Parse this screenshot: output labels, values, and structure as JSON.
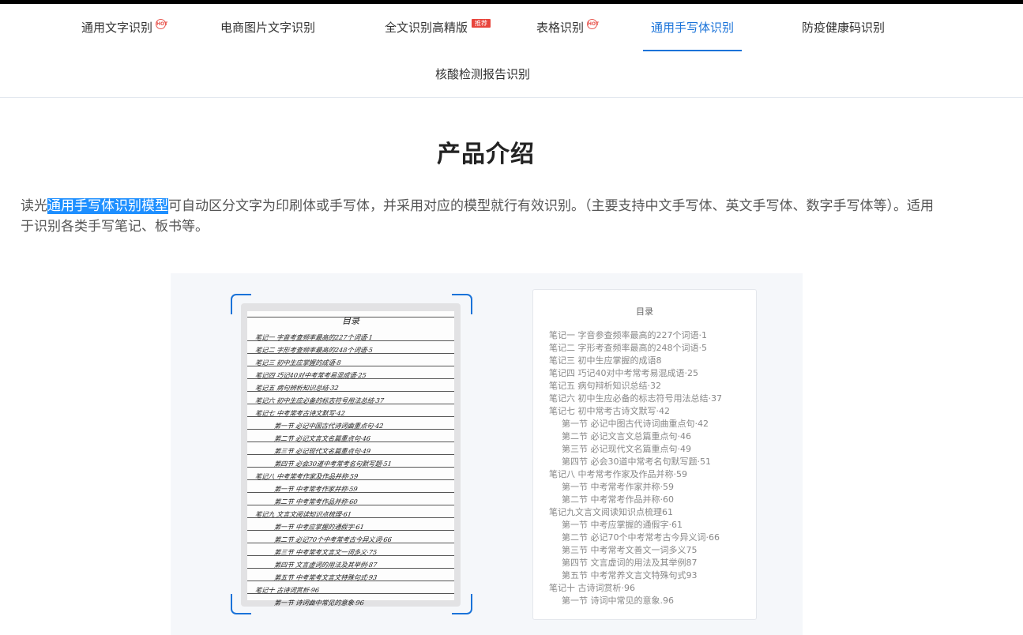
{
  "tabs": [
    {
      "label": "通用文字识别",
      "badge": "HOT"
    },
    {
      "label": "电商图片文字识别",
      "badge": ""
    },
    {
      "label": "全文识别高精版",
      "badge": "推荐"
    },
    {
      "label": "表格识别",
      "badge": "HOT"
    },
    {
      "label": "通用手写体识别",
      "badge": ""
    },
    {
      "label": "防疫健康码识别",
      "badge": ""
    },
    {
      "label": "核酸检测报告识别",
      "badge": ""
    }
  ],
  "section_title": "产品介绍",
  "intro": {
    "prefix": "读光",
    "highlight": "通用手写体识别模型",
    "suffix": "可自动区分文字为印刷体或手写体，并采用对应的模型就行有效识别。（主要支持中文手写体、英文手写体、数字手写体等）。适用于识别各类手写笔记、板书等。"
  },
  "handwritten": {
    "title": "目录",
    "lines": [
      "笔记一  字音考查频率最高的227个词语·1",
      "笔记二  字形考查频率最高的248个词语·5",
      "笔记三  初中生应掌握的成语·8",
      "笔记四  巧记40对中考常考易混成语·25",
      "笔记五  病句辨析知识总结·32",
      "笔记六  初中生应必备的标志符号用法总结·37",
      "笔记七  中考常考古诗文默写·42",
      "第一节  必记中国古代诗词曲重点句·42",
      "第二节  必记文言文名篇重点句·46",
      "第三节  必记现代文名篇重点句·49",
      "第四节  必会30道中考常考名句默写题·51",
      "笔记八  中考常考作家及作品并称·59",
      "第一节  中考常考作家并称·59",
      "第二节  中考常考作品并称·60",
      "笔记九  文言文阅读知识点梳理·61",
      "第一节  中考应掌握的通假字·61",
      "第二节  必记70个中考常考古今异义词·66",
      "第三节  中考常考文言文一词多义·75",
      "第四节  文言虚词的用法及其举例·87",
      "第五节  中考常考文言文特殊句式·93",
      "笔记十  古诗词赏析·96",
      "第一节  诗词曲中常见的意象·96"
    ]
  },
  "toc": {
    "title": "目录",
    "lines": [
      {
        "text": "笔记一 字音参查频率最高的227个词语·1",
        "sub": false
      },
      {
        "text": "笔记二 字形考查频率最高的248个词语·5",
        "sub": false
      },
      {
        "text": "笔记三 初中生应掌握的成语8",
        "sub": false
      },
      {
        "text": "笔记四 巧记40对中考常考易混成语·25",
        "sub": false
      },
      {
        "text": "笔记五 病句辩析知识总结·32",
        "sub": false
      },
      {
        "text": "笔记六 初中生应必备的标志符号用法总结·37",
        "sub": false
      },
      {
        "text": "笔记七 初中常考古诗文默写·42",
        "sub": false
      },
      {
        "text": "第一节 必记中图古代诗词曲重点句·42",
        "sub": true
      },
      {
        "text": "第二节 必记文言文总篇重点句·46",
        "sub": true
      },
      {
        "text": "第三节 必记现代文名篇重点句·49",
        "sub": true
      },
      {
        "text": "第四节 必会30道中常考名句默写题·51",
        "sub": true
      },
      {
        "text": "笔记八 中考常考作家及作品并称·59",
        "sub": false
      },
      {
        "text": "第一节 中考常考作家并称·59",
        "sub": true
      },
      {
        "text": "第二节 中考常考作品并称·60",
        "sub": true
      },
      {
        "text": "笔记九文言文阅读知识点梳理61",
        "sub": false
      },
      {
        "text": "第一节 中考应掌握的通假字·61",
        "sub": true
      },
      {
        "text": "第二节 必记70个中考常考古今异义词·66",
        "sub": true
      },
      {
        "text": "第三节 中考常考文善文一词多义75",
        "sub": true
      },
      {
        "text": "第四节 文言虚词的用法及其举例87",
        "sub": true
      },
      {
        "text": "第五节 中考常养文言文特殊句式93",
        "sub": true
      },
      {
        "text": "笔记十 古诗词赏析·96",
        "sub": false
      },
      {
        "text": "第一节 诗词中常见的意象.96",
        "sub": true
      }
    ]
  },
  "colors": {
    "accent": "#1a73d9",
    "highlight": "#1e8fff",
    "hot": "#e8564f"
  }
}
